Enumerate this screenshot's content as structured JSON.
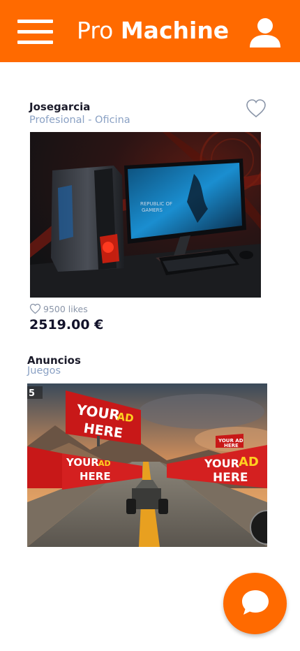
{
  "header": {
    "title_light": "Pro ",
    "title_bold": "Machine",
    "bg_color": "#ff6a00"
  },
  "posts": [
    {
      "author": "Josegarcia",
      "category": "Profesional - Oficina",
      "image_alt": "ROG gaming desktop and curved monitor",
      "likes": "9500 likes",
      "price": "2519.00 €"
    },
    {
      "author": "Anuncios",
      "category": "Juegos",
      "image_alt": "Racing game with YOUR AD HERE billboards",
      "billboard_text_1": "YOUR",
      "billboard_text_2": "AD",
      "billboard_text_3": "HERE",
      "hud_number": "5"
    }
  ],
  "icons": {
    "menu": "hamburger-menu-icon",
    "user": "user-icon",
    "favorite": "heart-outline-icon",
    "likes": "heart-small-icon",
    "chat": "chat-bubble-icon"
  }
}
